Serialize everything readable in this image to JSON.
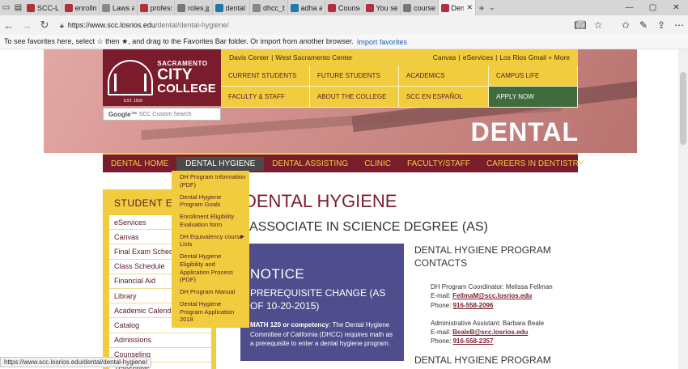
{
  "browser": {
    "tabs": [
      {
        "label": "SCC-LOGC",
        "favicon_color": "#b03040"
      },
      {
        "label": "enrollmen",
        "favicon_color": "#b03040"
      },
      {
        "label": "Laws and I",
        "favicon_color": "#888888"
      },
      {
        "label": "profession",
        "favicon_color": "#b03040"
      },
      {
        "label": "roles.jpg",
        "favicon_color": "#777777"
      },
      {
        "label": "dental hyg",
        "favicon_color": "#1e7aa8"
      },
      {
        "label": "dhcc_banr",
        "favicon_color": "#888888"
      },
      {
        "label": "adha annu",
        "favicon_color": "#1e7aa8"
      },
      {
        "label": "Counselin",
        "favicon_color": "#b03040"
      },
      {
        "label": "You search",
        "favicon_color": "#b03040"
      },
      {
        "label": "course-sul",
        "favicon_color": "#777777"
      },
      {
        "label": "Dental",
        "favicon_color": "#b03040"
      }
    ],
    "url_host": "https://www.scc.losrios.edu",
    "url_path": "/dental/dental-hygiene/",
    "favorites_text": "To see favorites here, select ☆ then ★, and drag to the Favorites Bar folder. Or import from another browser.",
    "favorites_link": "Import favorites",
    "status_url": "https://www.scc.losrios.edu/dental/dental-hygiene/"
  },
  "header": {
    "logo_line1": "SACRAMENTO",
    "logo_line2": "CITY",
    "logo_line3": "COLLEGE",
    "logo_est": "EST. 1916",
    "search_brand": "Google™",
    "search_placeholder": "SCC Custom Search",
    "top_left": [
      "Davis Center",
      "|",
      "West Sacramento Center"
    ],
    "top_right": [
      "Canvas",
      "|",
      "eServices",
      "|",
      "Los Rios Gmail + More"
    ],
    "main_nav": [
      "CURRENT STUDENTS",
      "FUTURE STUDENTS",
      "ACADEMICS",
      "CAMPUS LIFE",
      "FACULTY & STAFF",
      "ABOUT THE COLLEGE",
      "SCC EN ESPAÑOL",
      "APPLY NOW"
    ],
    "hero_word": "DENTAL"
  },
  "dept_nav": [
    "DENTAL HOME",
    "DENTAL HYGIENE",
    "DENTAL ASSISTING",
    "CLINIC",
    "FACULTY/STAFF",
    "CAREERS IN DENTISTRY"
  ],
  "dropdown": [
    "DH Program Information (PDF)",
    "Dental Hygiene Program Goals",
    "Enrollment Eligibility Evaluation form",
    "DH Equivalency course Lists",
    "Dental Hygiene Eligibility and Application Process (PDF)",
    "DH Program Manual",
    "Dental Hygiene Program Application 2018"
  ],
  "sidebar": {
    "title": "STUDENT ESSENTIALS",
    "items": [
      "eServices",
      "Canvas",
      "Final Exam Schedule",
      "Class Schedule",
      "Financial Aid",
      "Library",
      "Academic Calendar",
      "Catalog",
      "Admissions",
      "Counseling",
      "Transcripts"
    ]
  },
  "main": {
    "title": "DENTAL HYGIENE",
    "subtitle": "ASSOCIATE IN SCIENCE DEGREE (AS)"
  },
  "notice": {
    "title": "NOTICE",
    "subtitle": "PREREQUISITE CHANGE (AS OF 10-20-2015)",
    "body_bold": "MATH 120 or competency",
    "body_rest": ": The Dental Hygiene Committee of California (DHCC) requires math as a prerequisite to enter a dental hygiene program."
  },
  "contacts": {
    "title": "DENTAL HYGIENE PROGRAM CONTACTS",
    "coordinator": "DH Program Coordinator: Melissa Fellman",
    "coordinator_email_label": "E-mail:",
    "coordinator_email": "FellmaM@scc.losrios.edu",
    "coordinator_phone_label": "Phone:",
    "coordinator_phone": "916-558-2096",
    "assistant": "Administrative Assistant: Barbara Beale",
    "assistant_email_label": "E-mail:",
    "assistant_email": "BealeB@scc.losrios.edu",
    "assistant_phone_label": "Phone:",
    "assistant_phone": "916-558-2357",
    "title2": "DENTAL HYGIENE PROGRAM WEBSITES"
  }
}
